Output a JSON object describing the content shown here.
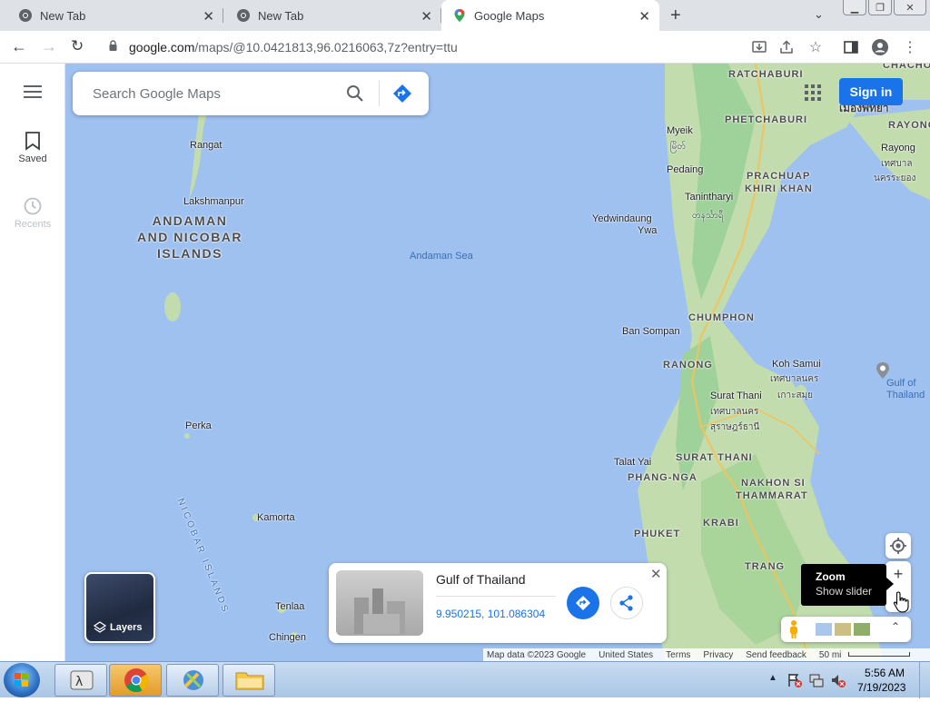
{
  "browser": {
    "tabs": [
      {
        "title": "New Tab"
      },
      {
        "title": "New Tab"
      },
      {
        "title": "Google Maps"
      }
    ],
    "url": "google.com/maps/@10.0421813,96.0216063,7z?entry=ttu",
    "url_host": "google.com",
    "url_path": "/maps/@10.0421813,96.0216063,7z?entry=ttu"
  },
  "sidebar": {
    "items": [
      {
        "label": "Saved"
      },
      {
        "label": "Recents"
      }
    ]
  },
  "search": {
    "placeholder": "Search Google Maps"
  },
  "header": {
    "signin_label": "Sign in"
  },
  "map_labels": {
    "ratchaburi": "RATCHABURI",
    "chachoeng": "CHACHO",
    "phetchaburi": "PHETCHABURI",
    "bangkok_th": "เมืองพัทยา",
    "rayong_region": "RAYONG",
    "rayong": "Rayong",
    "rayong_th1": "เทศบาล",
    "rayong_th2": "นครระยอง",
    "myeik": "Myeik",
    "myeik_my": "မြိတ်",
    "pedaing": "Pedaing",
    "prachuap1": "PRACHUAP",
    "prachuap2": "KHIRI KHAN",
    "tanintharyi": "Tanintharyi",
    "tanintharyi_my": "တနင်္သာရီ",
    "yedwindaung1": "Yedwindaung",
    "yedwindaung2": "Ywa",
    "rangat": "Rangat",
    "lakshmanpur": "Lakshmanpur",
    "andaman1": "ANDAMAN",
    "andaman2": "AND NICOBAR",
    "andaman3": "ISLANDS",
    "andaman_sea": "Andaman Sea",
    "chumphon": "CHUMPHON",
    "ban_sompan": "Ban Sompan",
    "ranong": "RANONG",
    "koh_samui": "Koh Samui",
    "koh_samui_th1": "เทศบาลนคร",
    "koh_samui_th2": "เกาะสมุย",
    "gulf1": "Gulf of",
    "gulf2": "Thailand",
    "surat": "Surat Thani",
    "surat_th1": "เทศบาลนคร",
    "surat_th2": "สุราษฎร์ธานี",
    "perka": "Perka",
    "nicobar_islands": "NICOBAR ISLANDS",
    "talat_yai": "Talat Yai",
    "phang_nga": "PHANG-NGA",
    "surat_region": "SURAT THANI",
    "nakhon1": "NAKHON SI",
    "nakhon2": "THAMMARAT",
    "kamorta": "Kamorta",
    "phuket": "PHUKET",
    "krabi": "KRABI",
    "trang": "TRANG",
    "tenlaa": "Tenlaa",
    "chingen": "Chingen"
  },
  "layers_label": "Layers",
  "place_card": {
    "title": "Gulf of Thailand",
    "coords": "9.950215, 101.086304"
  },
  "zoom_tooltip": {
    "title": "Zoom",
    "subtitle": "Show slider"
  },
  "footer": {
    "items": [
      "Map data ©2023 Google",
      "United States",
      "Terms",
      "Privacy",
      "Send feedback"
    ],
    "scale_label": "50 mi"
  },
  "taskbar": {
    "time": "5:56 AM",
    "date": "7/19/2023"
  },
  "colors": {
    "water": "#9fc1f0",
    "land": "#c2dcae",
    "accent": "#1a73e8"
  }
}
